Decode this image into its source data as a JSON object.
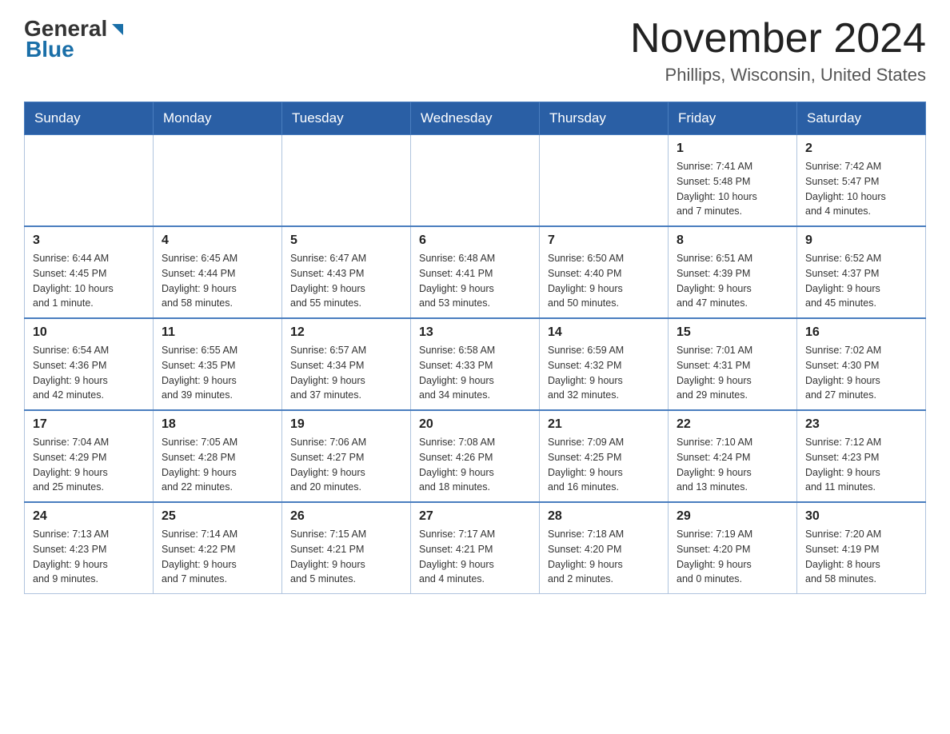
{
  "header": {
    "logo_general": "General",
    "logo_blue": "Blue",
    "month_title": "November 2024",
    "location": "Phillips, Wisconsin, United States"
  },
  "weekdays": [
    "Sunday",
    "Monday",
    "Tuesday",
    "Wednesday",
    "Thursday",
    "Friday",
    "Saturday"
  ],
  "weeks": [
    [
      {
        "day": "",
        "info": ""
      },
      {
        "day": "",
        "info": ""
      },
      {
        "day": "",
        "info": ""
      },
      {
        "day": "",
        "info": ""
      },
      {
        "day": "",
        "info": ""
      },
      {
        "day": "1",
        "info": "Sunrise: 7:41 AM\nSunset: 5:48 PM\nDaylight: 10 hours\nand 7 minutes."
      },
      {
        "day": "2",
        "info": "Sunrise: 7:42 AM\nSunset: 5:47 PM\nDaylight: 10 hours\nand 4 minutes."
      }
    ],
    [
      {
        "day": "3",
        "info": "Sunrise: 6:44 AM\nSunset: 4:45 PM\nDaylight: 10 hours\nand 1 minute."
      },
      {
        "day": "4",
        "info": "Sunrise: 6:45 AM\nSunset: 4:44 PM\nDaylight: 9 hours\nand 58 minutes."
      },
      {
        "day": "5",
        "info": "Sunrise: 6:47 AM\nSunset: 4:43 PM\nDaylight: 9 hours\nand 55 minutes."
      },
      {
        "day": "6",
        "info": "Sunrise: 6:48 AM\nSunset: 4:41 PM\nDaylight: 9 hours\nand 53 minutes."
      },
      {
        "day": "7",
        "info": "Sunrise: 6:50 AM\nSunset: 4:40 PM\nDaylight: 9 hours\nand 50 minutes."
      },
      {
        "day": "8",
        "info": "Sunrise: 6:51 AM\nSunset: 4:39 PM\nDaylight: 9 hours\nand 47 minutes."
      },
      {
        "day": "9",
        "info": "Sunrise: 6:52 AM\nSunset: 4:37 PM\nDaylight: 9 hours\nand 45 minutes."
      }
    ],
    [
      {
        "day": "10",
        "info": "Sunrise: 6:54 AM\nSunset: 4:36 PM\nDaylight: 9 hours\nand 42 minutes."
      },
      {
        "day": "11",
        "info": "Sunrise: 6:55 AM\nSunset: 4:35 PM\nDaylight: 9 hours\nand 39 minutes."
      },
      {
        "day": "12",
        "info": "Sunrise: 6:57 AM\nSunset: 4:34 PM\nDaylight: 9 hours\nand 37 minutes."
      },
      {
        "day": "13",
        "info": "Sunrise: 6:58 AM\nSunset: 4:33 PM\nDaylight: 9 hours\nand 34 minutes."
      },
      {
        "day": "14",
        "info": "Sunrise: 6:59 AM\nSunset: 4:32 PM\nDaylight: 9 hours\nand 32 minutes."
      },
      {
        "day": "15",
        "info": "Sunrise: 7:01 AM\nSunset: 4:31 PM\nDaylight: 9 hours\nand 29 minutes."
      },
      {
        "day": "16",
        "info": "Sunrise: 7:02 AM\nSunset: 4:30 PM\nDaylight: 9 hours\nand 27 minutes."
      }
    ],
    [
      {
        "day": "17",
        "info": "Sunrise: 7:04 AM\nSunset: 4:29 PM\nDaylight: 9 hours\nand 25 minutes."
      },
      {
        "day": "18",
        "info": "Sunrise: 7:05 AM\nSunset: 4:28 PM\nDaylight: 9 hours\nand 22 minutes."
      },
      {
        "day": "19",
        "info": "Sunrise: 7:06 AM\nSunset: 4:27 PM\nDaylight: 9 hours\nand 20 minutes."
      },
      {
        "day": "20",
        "info": "Sunrise: 7:08 AM\nSunset: 4:26 PM\nDaylight: 9 hours\nand 18 minutes."
      },
      {
        "day": "21",
        "info": "Sunrise: 7:09 AM\nSunset: 4:25 PM\nDaylight: 9 hours\nand 16 minutes."
      },
      {
        "day": "22",
        "info": "Sunrise: 7:10 AM\nSunset: 4:24 PM\nDaylight: 9 hours\nand 13 minutes."
      },
      {
        "day": "23",
        "info": "Sunrise: 7:12 AM\nSunset: 4:23 PM\nDaylight: 9 hours\nand 11 minutes."
      }
    ],
    [
      {
        "day": "24",
        "info": "Sunrise: 7:13 AM\nSunset: 4:23 PM\nDaylight: 9 hours\nand 9 minutes."
      },
      {
        "day": "25",
        "info": "Sunrise: 7:14 AM\nSunset: 4:22 PM\nDaylight: 9 hours\nand 7 minutes."
      },
      {
        "day": "26",
        "info": "Sunrise: 7:15 AM\nSunset: 4:21 PM\nDaylight: 9 hours\nand 5 minutes."
      },
      {
        "day": "27",
        "info": "Sunrise: 7:17 AM\nSunset: 4:21 PM\nDaylight: 9 hours\nand 4 minutes."
      },
      {
        "day": "28",
        "info": "Sunrise: 7:18 AM\nSunset: 4:20 PM\nDaylight: 9 hours\nand 2 minutes."
      },
      {
        "day": "29",
        "info": "Sunrise: 7:19 AM\nSunset: 4:20 PM\nDaylight: 9 hours\nand 0 minutes."
      },
      {
        "day": "30",
        "info": "Sunrise: 7:20 AM\nSunset: 4:19 PM\nDaylight: 8 hours\nand 58 minutes."
      }
    ]
  ]
}
